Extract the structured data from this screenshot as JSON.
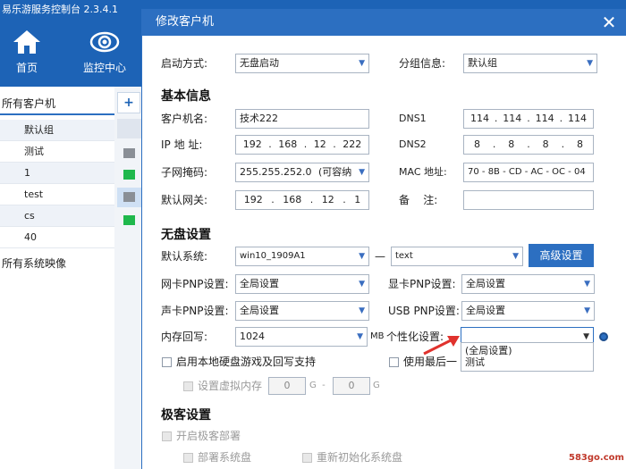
{
  "app": {
    "title": "易乐游服务控制台 2.3.4.1",
    "nav": [
      {
        "label": "首页",
        "icon": "home-icon"
      },
      {
        "label": "监控中心",
        "icon": "eye-icon"
      }
    ],
    "tree": {
      "clients_root": "所有客户机",
      "groups": [
        "默认组",
        "测试",
        "1",
        "test",
        "cs",
        "40"
      ],
      "images_root": "所有系统映像"
    },
    "add_symbol": "+"
  },
  "dialog": {
    "title": "修改客户机",
    "boot_mode": {
      "label": "启动方式:",
      "value": "无盘启动"
    },
    "group": {
      "label": "分组信息:",
      "value": "默认组"
    },
    "basic_section": "基本信息",
    "client_name": {
      "label": "客户机名:",
      "value": "技术222"
    },
    "ip": {
      "label": "IP 地 址:",
      "octets": [
        "192",
        "168",
        "12",
        "222"
      ]
    },
    "subnet": {
      "label": "子网掩码:",
      "value": "255.255.252.0",
      "suffix": "(可容纳"
    },
    "gateway": {
      "label": "默认网关:",
      "octets": [
        "192",
        "168",
        "12",
        "1"
      ]
    },
    "dns1": {
      "label": "DNS1",
      "octets": [
        "114",
        "114",
        "114",
        "114"
      ]
    },
    "dns2": {
      "label": "DNS2",
      "octets": [
        "8",
        "8",
        "8",
        "8"
      ]
    },
    "mac": {
      "label": "MAC 地址:",
      "value": "70 - 8B - CD - AC - OC - 04"
    },
    "note": {
      "label": "备    注:",
      "value": ""
    },
    "diskless_section": "无盘设置",
    "default_system": {
      "label": "默认系统:",
      "value": "win10_1909A1"
    },
    "dash": "—",
    "system_extra": {
      "value": "text"
    },
    "advanced_button": "高级设置",
    "nic_pnp": {
      "label": "网卡PNP设置:",
      "value": "全局设置"
    },
    "gpu_pnp": {
      "label": "显卡PNP设置:",
      "value": "全局设置"
    },
    "audio_pnp": {
      "label": "声卡PNP设置:",
      "value": "全局设置"
    },
    "usb_pnp": {
      "label": "USB PNP设置:",
      "value": "全局设置"
    },
    "mem_writeback": {
      "label": "内存回写:",
      "value": "1024",
      "unit": "MB"
    },
    "personalize": {
      "label": "个性化设置:",
      "value": "",
      "options": [
        "(全局设置)",
        "测试"
      ]
    },
    "local_disk_game": "启用本地硬盘游戏及回写支持",
    "use_last": "使用最后一",
    "virtual_mem": {
      "label": "设置虚拟内存",
      "min": "0",
      "max": "0",
      "unit": "G",
      "sep": "G  -"
    },
    "super_section": "极客设置",
    "enable_super": "开启极客部署",
    "deploy_system": "部署系统盘",
    "reinit_system": "重新初始化系统盘"
  },
  "watermark": "583go.com",
  "colors": {
    "accent": "#2c6fc1",
    "app_blue": "#1d63b6",
    "arrow_red": "#e0322d"
  }
}
